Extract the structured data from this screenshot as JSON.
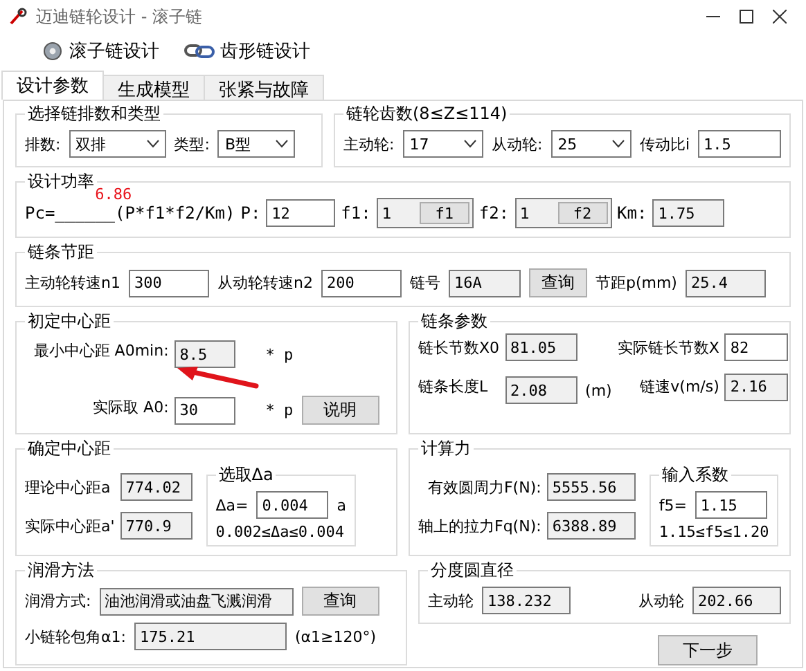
{
  "window": {
    "title": "迈迪链轮设计 - 滚子链"
  },
  "toolbar": [
    {
      "label": "滚子链设计"
    },
    {
      "label": "齿形链设计"
    }
  ],
  "tabs": [
    {
      "label": "设计参数",
      "selected": true
    },
    {
      "label": "生成模型",
      "selected": false
    },
    {
      "label": "张紧与故障",
      "selected": false
    }
  ],
  "chain_rows": {
    "title": "选择链排数和类型",
    "rows_label": "排数:",
    "rows_value": "双排",
    "type_label": "类型:",
    "type_value": "B型"
  },
  "teeth": {
    "title": "链轮齿数(8≤Z≤114)",
    "driver_label": "主动轮:",
    "driver_value": "17",
    "driven_label": "从动轮:",
    "driven_value": "25",
    "ratio_label": "传动比i",
    "ratio_value": "1.5"
  },
  "power": {
    "title": "设计功率",
    "formula": "Pc=______(P*f1*f2/Km)",
    "result": "6.86",
    "p_label": "P:",
    "p_value": "12",
    "f1_label": "f1:",
    "f1_value": "1",
    "f1_button": "f1",
    "f2_label": "f2:",
    "f2_value": "1",
    "f2_button": "f2",
    "km_label": "Km:",
    "km_value": "1.75"
  },
  "pitch": {
    "title": "链条节距",
    "n1_label": "主动轮转速n1",
    "n1_value": "300",
    "n2_label": "从动轮转速n2",
    "n2_value": "200",
    "chain_no_label": "链号",
    "chain_no_value": "16A",
    "query_button": "查询",
    "pitch_label": "节距p(mm)",
    "pitch_value": "25.4"
  },
  "initial_center": {
    "title": "初定中心距",
    "min_label": "最小中心距 A0min:",
    "min_value": "8.5",
    "min_unit": "* p",
    "actual_label": "实际取 A0:",
    "actual_value": "30",
    "actual_unit": "* p",
    "help_button": "说明"
  },
  "chain_params": {
    "title": "链条参数",
    "links_label": "链长节数X0",
    "links_value": "81.05",
    "actual_links_label": "实际链长节数X",
    "actual_links_value": "82",
    "length_label": "链条长度L",
    "length_value": "2.08",
    "length_unit": "(m)",
    "speed_label": "链速v(m/s)",
    "speed_value": "2.16"
  },
  "center": {
    "title": "确定中心距",
    "theory_label": "理论中心距a",
    "theory_value": "774.02",
    "actual_label": "实际中心距a'",
    "actual_value": "770.9",
    "delta": {
      "title": "选取Δa",
      "label": "Δa=",
      "value": "0.004",
      "unit": "a",
      "range": "0.002≤Δa≤0.004"
    }
  },
  "force": {
    "title": "计算力",
    "effective_label": "有效圆周力F(N):",
    "effective_value": "5555.56",
    "shaft_label": "轴上的拉力Fq(N):",
    "shaft_value": "6388.89",
    "coef": {
      "title": "输入系数",
      "label": "f5=",
      "value": "1.15",
      "range": "1.15≤f5≤1.20"
    }
  },
  "lubrication": {
    "title": "润滑方法",
    "method_label": "润滑方式:",
    "method_value": "油池润滑或油盘飞溅润滑",
    "query_button": "查询",
    "wrap_label": "小链轮包角α1:",
    "wrap_value": "175.21",
    "wrap_note": "(α1≥120°)"
  },
  "pitch_diameter": {
    "title": "分度圆直径",
    "driver_label": "主动轮",
    "driver_value": "138.232",
    "driven_label": "从动轮",
    "driven_value": "202.66"
  },
  "next_button": "下一步"
}
